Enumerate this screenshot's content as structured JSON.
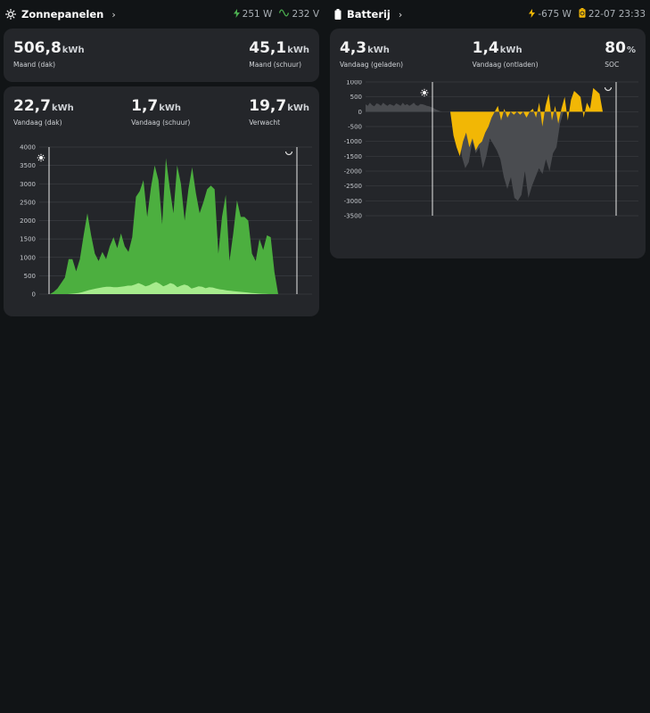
{
  "solar": {
    "title": "Zonnepanelen",
    "power": "251 W",
    "voltage": "232 V",
    "month_cards": [
      {
        "value": "506,8",
        "unit": "kWh",
        "label": "Maand (dak)"
      },
      {
        "value": "45,1",
        "unit": "kWh",
        "label": "Maand (schuur)"
      }
    ],
    "today_cards": [
      {
        "value": "22,7",
        "unit": "kWh",
        "label": "Vandaag (dak)"
      },
      {
        "value": "1,7",
        "unit": "kWh",
        "label": "Vandaag (schuur)"
      },
      {
        "value": "19,7",
        "unit": "kWh",
        "label": "Verwacht"
      }
    ]
  },
  "battery": {
    "title": "Batterij",
    "power": "-675 W",
    "datetime": "22-07 23:33",
    "cards": [
      {
        "value": "4,3",
        "unit": "kWh",
        "label": "Vandaag (geladen)"
      },
      {
        "value": "1,4",
        "unit": "kWh",
        "label": "Vandaag (ontladen)"
      },
      {
        "value": "80",
        "unit": "%",
        "label": "SOC"
      }
    ]
  },
  "colors": {
    "background": "#111416",
    "card": "#24262a",
    "solar_dark": "#4caf3f",
    "solar_light": "#a7eb8d",
    "battery_charge": "#f2b705",
    "battery_grey": "#4a4c50",
    "accent_green": "#4caf50",
    "accent_yellow": "#f2b705"
  },
  "chart_data": [
    {
      "type": "area",
      "ylim": [
        0,
        4000
      ],
      "yticks": [
        "4000",
        "3500",
        "3000",
        "2500",
        "2000",
        "1500",
        "1000",
        "500",
        "0"
      ],
      "series": [
        {
          "values": [
            0,
            60,
            150,
            300,
            450,
            950,
            950,
            620,
            950,
            1600,
            2200,
            1600,
            1100,
            900,
            1150,
            950,
            1300,
            1550,
            1250,
            1650,
            1300,
            1150,
            1550,
            2650,
            2800,
            3100,
            2100,
            2900,
            3500,
            3100,
            1900,
            3700,
            2900,
            2200,
            3500,
            3000,
            2000,
            2850,
            3450,
            2750,
            2200,
            2500,
            2850,
            2950,
            2850,
            1100,
            2100,
            2700,
            900,
            1650,
            2550,
            2100,
            2100,
            2000,
            1100,
            900,
            1500,
            1200,
            1600,
            1550,
            600,
            0
          ]
        },
        {
          "values": [
            0,
            10,
            20,
            30,
            50,
            80,
            110,
            130,
            150,
            170,
            190,
            200,
            200,
            190,
            190,
            200,
            210,
            230,
            230,
            260,
            300,
            260,
            210,
            240,
            290,
            330,
            280,
            210,
            250,
            300,
            270,
            190,
            230,
            260,
            230,
            150,
            180,
            210,
            200,
            160,
            190,
            180,
            150,
            130,
            120,
            100,
            90,
            80,
            70,
            60,
            50,
            40,
            30,
            25,
            15,
            10,
            5,
            0
          ]
        }
      ]
    },
    {
      "type": "area",
      "ylim": [
        -3500,
        1000
      ],
      "yticks": [
        "1000",
        "500",
        "0",
        "-500",
        "-1000",
        "-1500",
        "-2000",
        "-2500",
        "-3000",
        "-3500"
      ],
      "series": [
        {
          "values": [
            250,
            200,
            300,
            220,
            180,
            280,
            260,
            200,
            300,
            240,
            200,
            260,
            230,
            200,
            280,
            240,
            200,
            300,
            220,
            260,
            200,
            240,
            300,
            220,
            200,
            260,
            250,
            230,
            200,
            180,
            150,
            120,
            80,
            50,
            20,
            0
          ]
        },
        {
          "values": [
            0,
            -800,
            -1200,
            -1500,
            -1000,
            -700,
            -1200,
            -900,
            -1300,
            -1100,
            -1000,
            -700,
            -500,
            -200,
            0,
            200,
            -300,
            100,
            -200,
            0,
            -100,
            0,
            -100,
            0,
            -200,
            0,
            100,
            -200,
            300,
            -500,
            200,
            600,
            -300,
            200,
            -400,
            100,
            500,
            -300,
            400,
            700,
            600,
            500,
            -200,
            300,
            100,
            800,
            700,
            600,
            0
          ]
        },
        {
          "values": [
            0,
            -200,
            -1500,
            -1900,
            -1700,
            -1000,
            -1400,
            -1200,
            -1900,
            -1500,
            -900,
            -1100,
            -1300,
            -1600,
            -2200,
            -2600,
            -2200,
            -2900,
            -3000,
            -2800,
            -2000,
            -2900,
            -2500,
            -2200,
            -1900,
            -2100,
            -1600,
            -2000,
            -1400,
            -1200,
            -400,
            0
          ]
        }
      ]
    }
  ]
}
